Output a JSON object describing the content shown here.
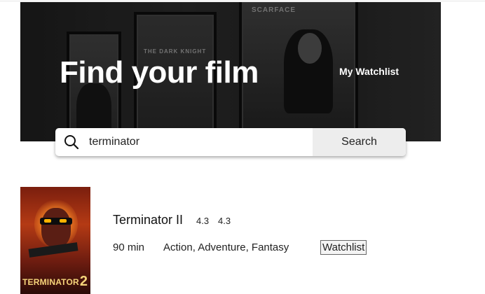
{
  "hero": {
    "title": "Find your film",
    "watchlist_link": "My Watchlist",
    "frame_captions": [
      "THE DARK KNIGHT",
      "SCARFACE"
    ]
  },
  "search": {
    "value": "terminator",
    "placeholder": "",
    "button_label": "Search"
  },
  "results": [
    {
      "title": "Terminator II",
      "rating_a": "4.3",
      "rating_b": "4.3",
      "runtime": "90 min",
      "genres": "Action, Adventure, Fantasy",
      "watchlist_label": "Watchlist",
      "poster_title": "TERMINATOR",
      "poster_number": "2"
    }
  ]
}
